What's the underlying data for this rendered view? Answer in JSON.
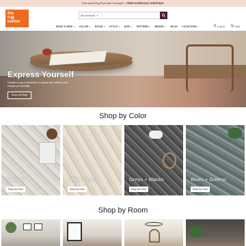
{
  "promo": {
    "lead": "Free Area Rug Pad with Purchase*",
    "divider": " • ",
    "highlight": "FREE EVERYDAY SHIPPING*"
  },
  "logo": {
    "line1": "the",
    "line2": "rug",
    "line3": "corner"
  },
  "search": {
    "category": "All products",
    "placeholder": "",
    "button_icon": "search-icon"
  },
  "nav": {
    "items": [
      {
        "label": "WHAT'S NEW"
      },
      {
        "label": "COLOR"
      },
      {
        "label": "ROOM"
      },
      {
        "label": "STYLE"
      },
      {
        "label": "SIZE"
      },
      {
        "label": "PATTERN"
      },
      {
        "label": "BRAND"
      },
      {
        "label": "BLOG"
      },
      {
        "label": "LOCATIONS"
      }
    ]
  },
  "account": {
    "login_icon": "user-icon",
    "login": "Log In",
    "cart_icon": "cart-icon",
    "cart": "Cart"
  },
  "hero": {
    "title": "Express Yourself",
    "subtitle": "Create a rug to transform a space and reflect your unique personality.",
    "button": "Shop all Rugs"
  },
  "shop_by_color": {
    "title": "Shop by Color",
    "tiles": [
      {
        "label": "Neutrals",
        "button": "Shop by Color"
      },
      {
        "label": "White + Ivory",
        "button": "Shop by Color"
      },
      {
        "label": "Greys + Blacks",
        "button": "Shop by Color"
      },
      {
        "label": "Blues + Greens",
        "button": "Shop by Color"
      }
    ]
  },
  "shop_by_room": {
    "title": "Shop by Room"
  },
  "colors": {
    "brand_orange": "#ee6a1f",
    "promo_bg": "#f3ddd3",
    "search_button": "#4b1f3a"
  }
}
